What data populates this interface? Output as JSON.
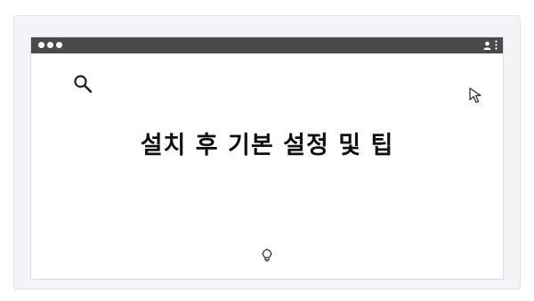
{
  "page": {
    "heading": "설치 후 기본 설정 및 팁"
  },
  "icons": {
    "window_controls": [
      "dot",
      "dot",
      "dot"
    ],
    "titlebar_right": [
      "user-icon",
      "kebab-menu-icon"
    ],
    "content": [
      "search-icon",
      "cursor-icon",
      "lightbulb-icon"
    ]
  },
  "colors": {
    "titlebar": "#4a4a4a",
    "frame_background": "#f2f4f7",
    "window_background": "#ffffff",
    "heading_text": "#111111"
  }
}
